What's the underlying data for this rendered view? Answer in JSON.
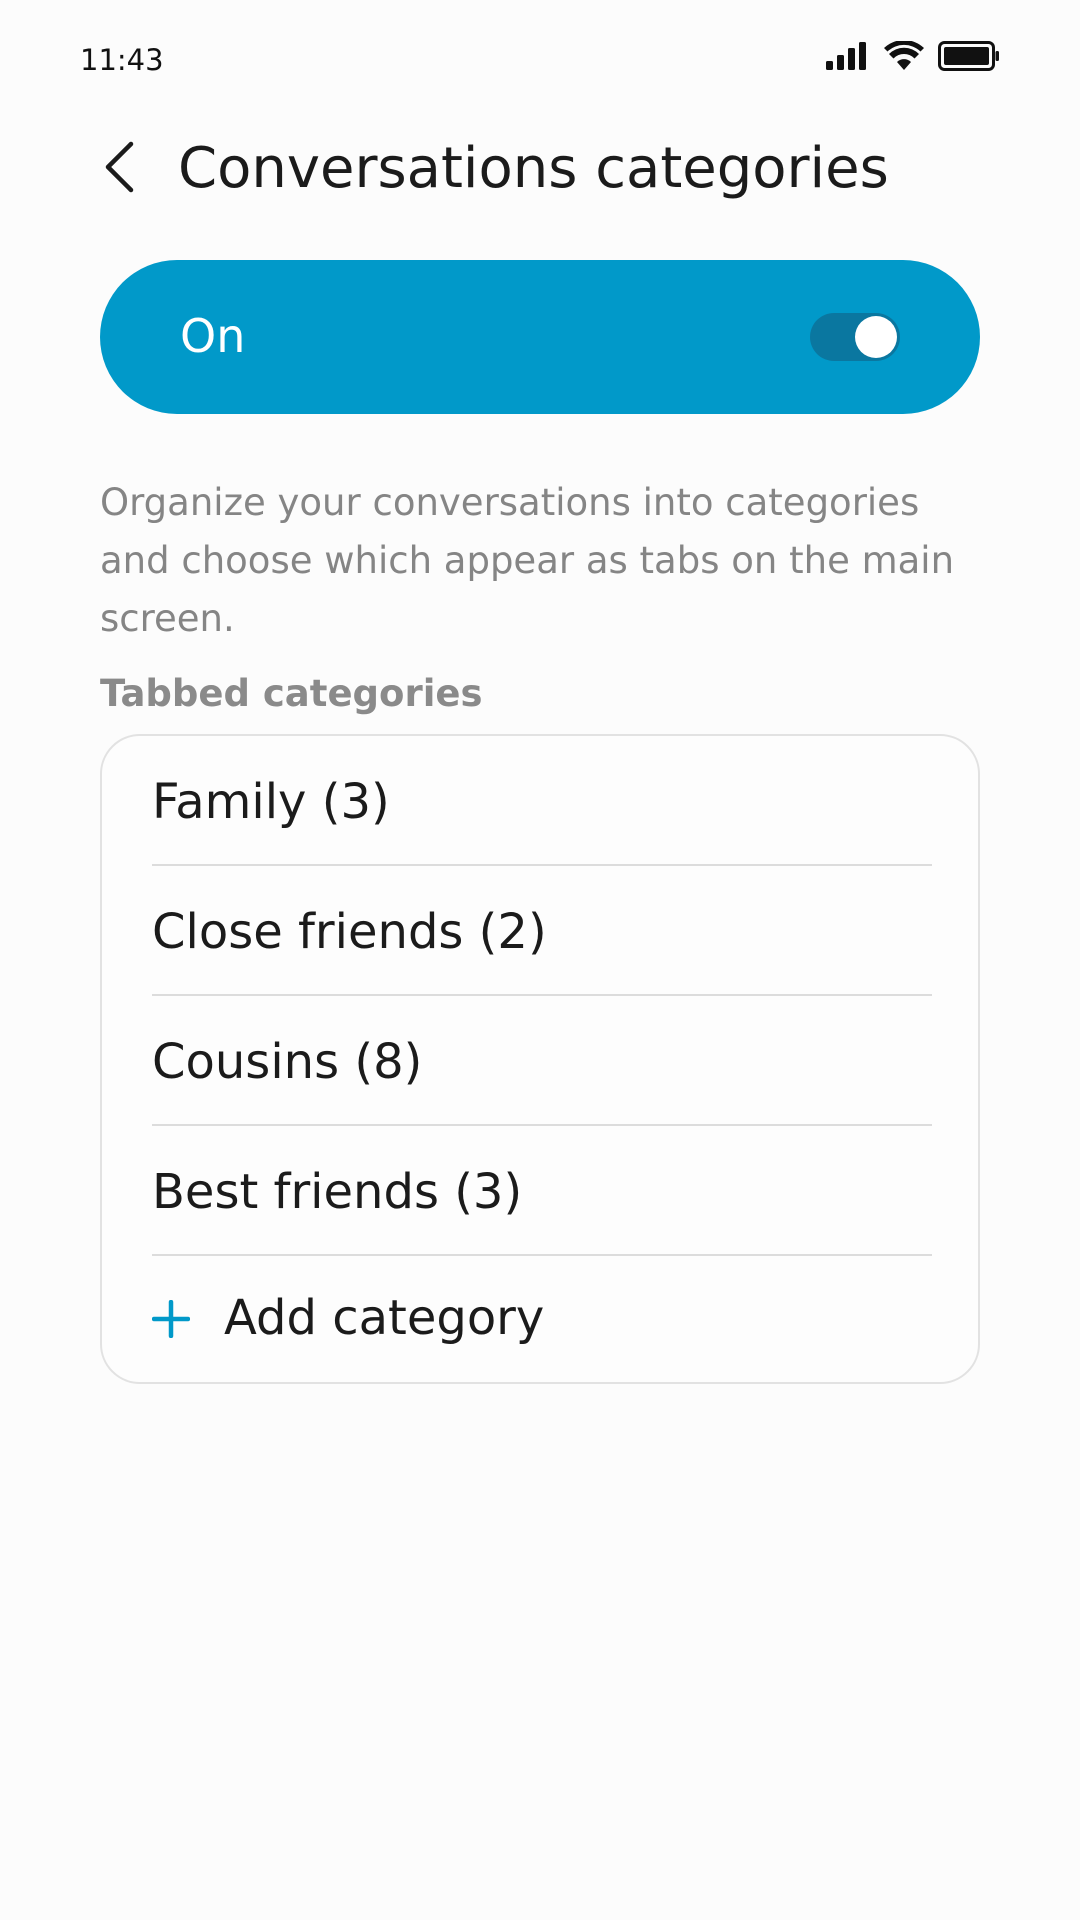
{
  "status_bar": {
    "time": "11:43",
    "icons": [
      "signal-icon",
      "wifi-icon",
      "battery-icon"
    ]
  },
  "header": {
    "back_icon": "chevron-left-icon",
    "title": "Conversations categories"
  },
  "master_switch": {
    "label": "On",
    "checked": true
  },
  "description": "Organize your conversations into categories and choose which appear as tabs on the main screen.",
  "section": {
    "title": "Tabbed categories",
    "items": [
      {
        "label": "Family (3)"
      },
      {
        "label": "Close friends (2)"
      },
      {
        "label": "Cousins (8)"
      },
      {
        "label": "Best friends (3)"
      }
    ],
    "add_label": "Add category",
    "add_icon": "plus-icon"
  },
  "colors": {
    "accent": "#0199c9",
    "toggle_track": "#0a77a0",
    "background": "#fcfcfc",
    "secondary_text": "#858585"
  }
}
